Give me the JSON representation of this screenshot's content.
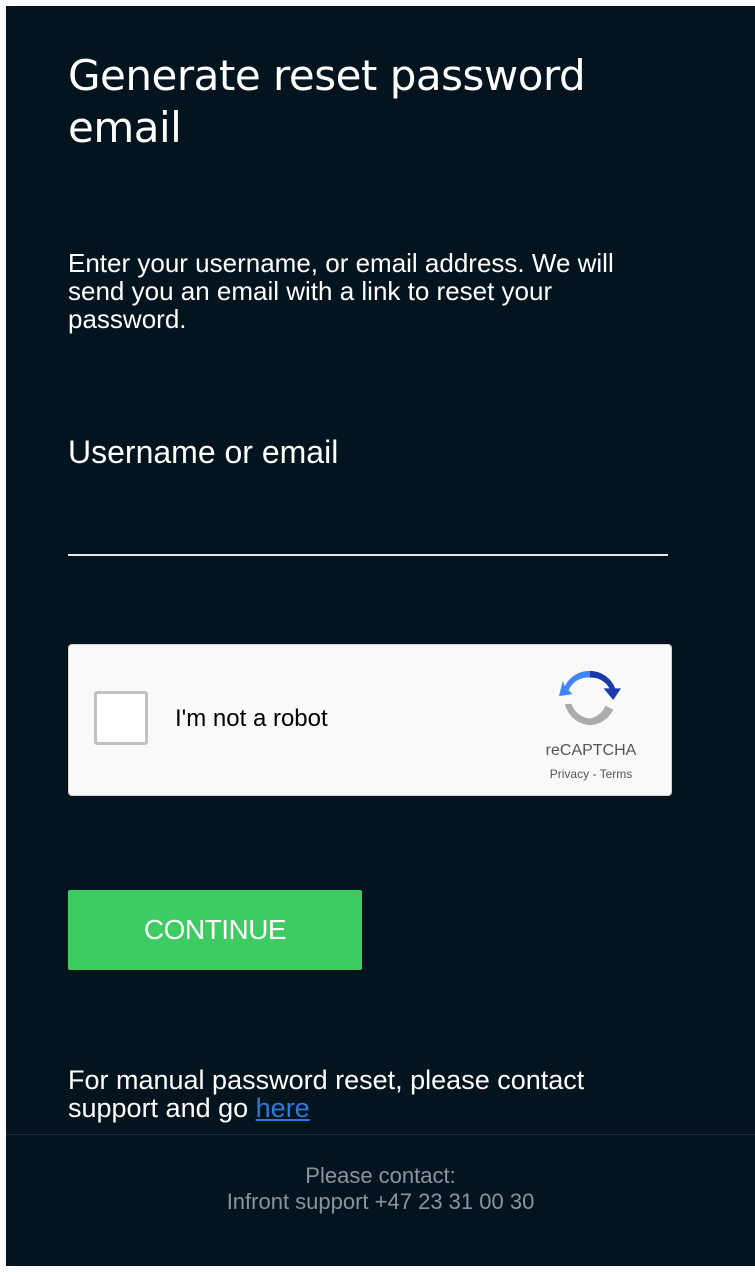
{
  "page": {
    "title": "Generate reset password email",
    "intro": "Enter your username, or email address. We will send you an email with a link to reset your password."
  },
  "form": {
    "field_label": "Username or email",
    "field_value": "",
    "continue_label": "CONTINUE"
  },
  "captcha": {
    "label": "I'm not a robot",
    "brand": "reCAPTCHA",
    "privacy": "Privacy",
    "separator": " - ",
    "terms": "Terms",
    "checked": false,
    "icon": "recaptcha-logo-icon"
  },
  "manual_reset": {
    "text": "For manual password reset, please contact support and go ",
    "link_text": "here"
  },
  "footer": {
    "line1": "Please contact:",
    "line2": "Infront support +47 23 31 00 30"
  },
  "colors": {
    "background": "#03141e",
    "accent_green": "#3ecb62",
    "link_blue": "#2f7bd9"
  }
}
